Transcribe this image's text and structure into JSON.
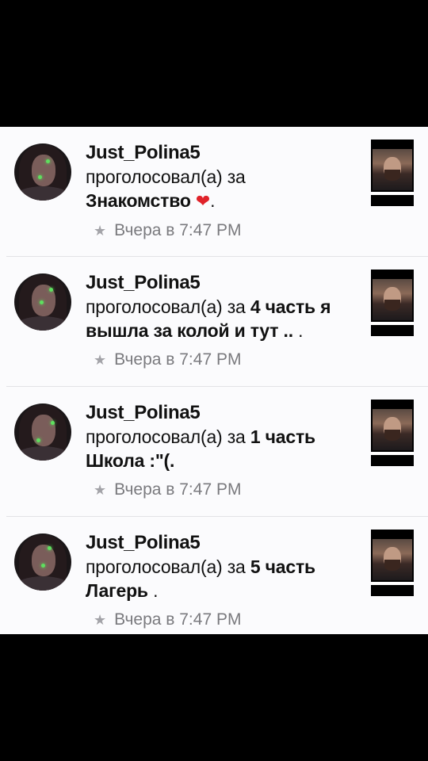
{
  "notifications": [
    {
      "username": "Just_Polina5",
      "action": "проголосовал(а) за",
      "title": "Знакомство",
      "title_suffix": ".",
      "has_heart": true,
      "heart_glyph": "❤",
      "time": "Вчера в 7:47 PM"
    },
    {
      "username": "Just_Polina5",
      "action": "проголосовал(а) за",
      "title": "4 часть я вышла за колой и тут ..",
      "title_suffix": " .",
      "has_heart": false,
      "heart_glyph": "",
      "time": "Вчера в 7:47 PM"
    },
    {
      "username": "Just_Polina5",
      "action": "проголосовал(а) за",
      "title": "1 часть Школа :\"(.",
      "title_suffix": "",
      "has_heart": false,
      "heart_glyph": "",
      "time": "Вчера в 7:47 PM"
    },
    {
      "username": "Just_Polina5",
      "action": "проголосовал(а) за",
      "title": "5 часть Лагерь",
      "title_suffix": " .",
      "has_heart": false,
      "heart_glyph": "",
      "time": "Вчера в 7:47 PM"
    }
  ],
  "icons": {
    "time_icon": "star-icon",
    "star_glyph": "★"
  },
  "colors": {
    "background": "#000000",
    "panel": "#fbfbfd",
    "text": "#111111",
    "meta": "#7a7a7e",
    "heart": "#e0222a"
  }
}
